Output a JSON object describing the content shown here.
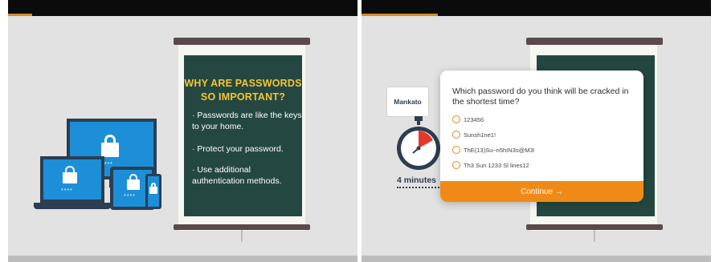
{
  "slide_left": {
    "board_title": "WHY ARE PASSWORDS SO IMPORTANT?",
    "bullets": [
      "· Passwords are like the keys to your home.",
      "· Protect your password.",
      "· Use additional authentication methods."
    ]
  },
  "slide_right": {
    "speech_bubble": "Mankato",
    "timer_label": "4 minutes",
    "quiz": {
      "question": "Which password do you think will be cracked in the shortest time?",
      "options": [
        "123456",
        "Sunsh1ne1!",
        "ThE(13)Su~n5hIN3s@M3!",
        "Th3 Sun 1233 Sl lines12"
      ],
      "continue_label": "Continue →"
    }
  },
  "colors": {
    "board": "#244841",
    "title": "#f4c534",
    "accent": "#f08a16",
    "device_screen": "#1d8fd8",
    "device_frame": "#2b3e52"
  }
}
